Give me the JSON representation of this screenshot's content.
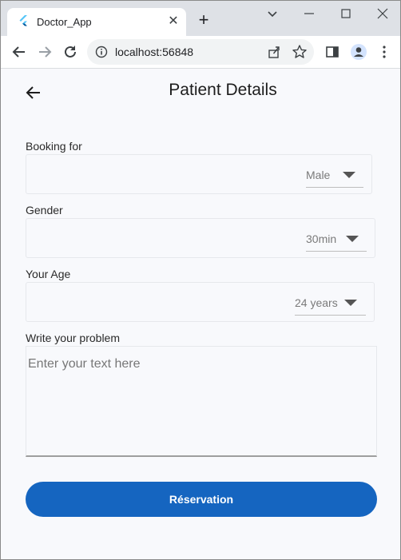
{
  "browser": {
    "tab_title": "Doctor_App",
    "url": "localhost:56848"
  },
  "page": {
    "title": "Patient Details",
    "fields": [
      {
        "label": "Booking for",
        "value": "Male"
      },
      {
        "label": "Gender",
        "value": "30min"
      },
      {
        "label": "Your Age",
        "value": "24 years"
      }
    ],
    "problem": {
      "label": "Write your problem",
      "placeholder": "Enter your text here",
      "value": ""
    },
    "reserve_label": "Réservation"
  },
  "colors": {
    "accent": "#1565c0",
    "page_background": "#f8f9fc"
  },
  "icons": {
    "favicon": "flutter-icon",
    "back": "back-arrow-icon",
    "browser_back": "arrow-left-icon",
    "browser_forward": "arrow-right-icon",
    "reload": "reload-icon",
    "info": "info-icon",
    "share": "share-icon",
    "bookmark": "star-icon",
    "side_panel": "side-panel-icon",
    "profile": "profile-icon",
    "menu": "kebab-menu-icon"
  }
}
